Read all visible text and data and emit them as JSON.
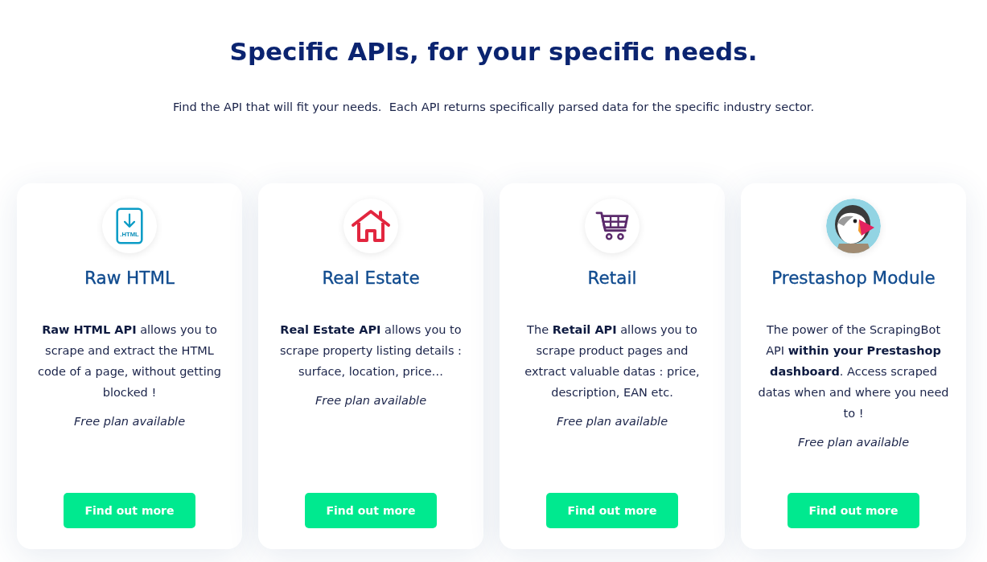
{
  "heading": "Specific APIs, for your specific needs.",
  "subtitle": "Find the API that will fit your needs.  Each API returns specifically parsed data for the specific industry sector.",
  "cards": [
    {
      "kind": "file",
      "icon_text": ".HTML",
      "title": "Raw HTML",
      "description": "**Raw HTML API** allows you to scrape and extract the HTML code of a page, without getting blocked !",
      "note": "Free plan available",
      "button": "Find out more"
    },
    {
      "kind": "house",
      "title": "Real Estate",
      "description": "**Real Estate API** allows you to scrape property listing details : surface, location, price…",
      "note": "Free plan available",
      "button": "Find out more"
    },
    {
      "kind": "cart",
      "title": "Retail",
      "description": "The **Retail API** allows you to scrape product pages and extract valuable datas : price, description, EAN etc.",
      "note": "Free plan available",
      "button": "Find out more"
    },
    {
      "kind": "bird",
      "title": "Prestashop Module",
      "description": "The power of the ScrapingBot API **within your Prestashop dashboard**. Access scraped datas when and where you need to !",
      "note": "Free plan available",
      "button": "Find out more"
    }
  ]
}
